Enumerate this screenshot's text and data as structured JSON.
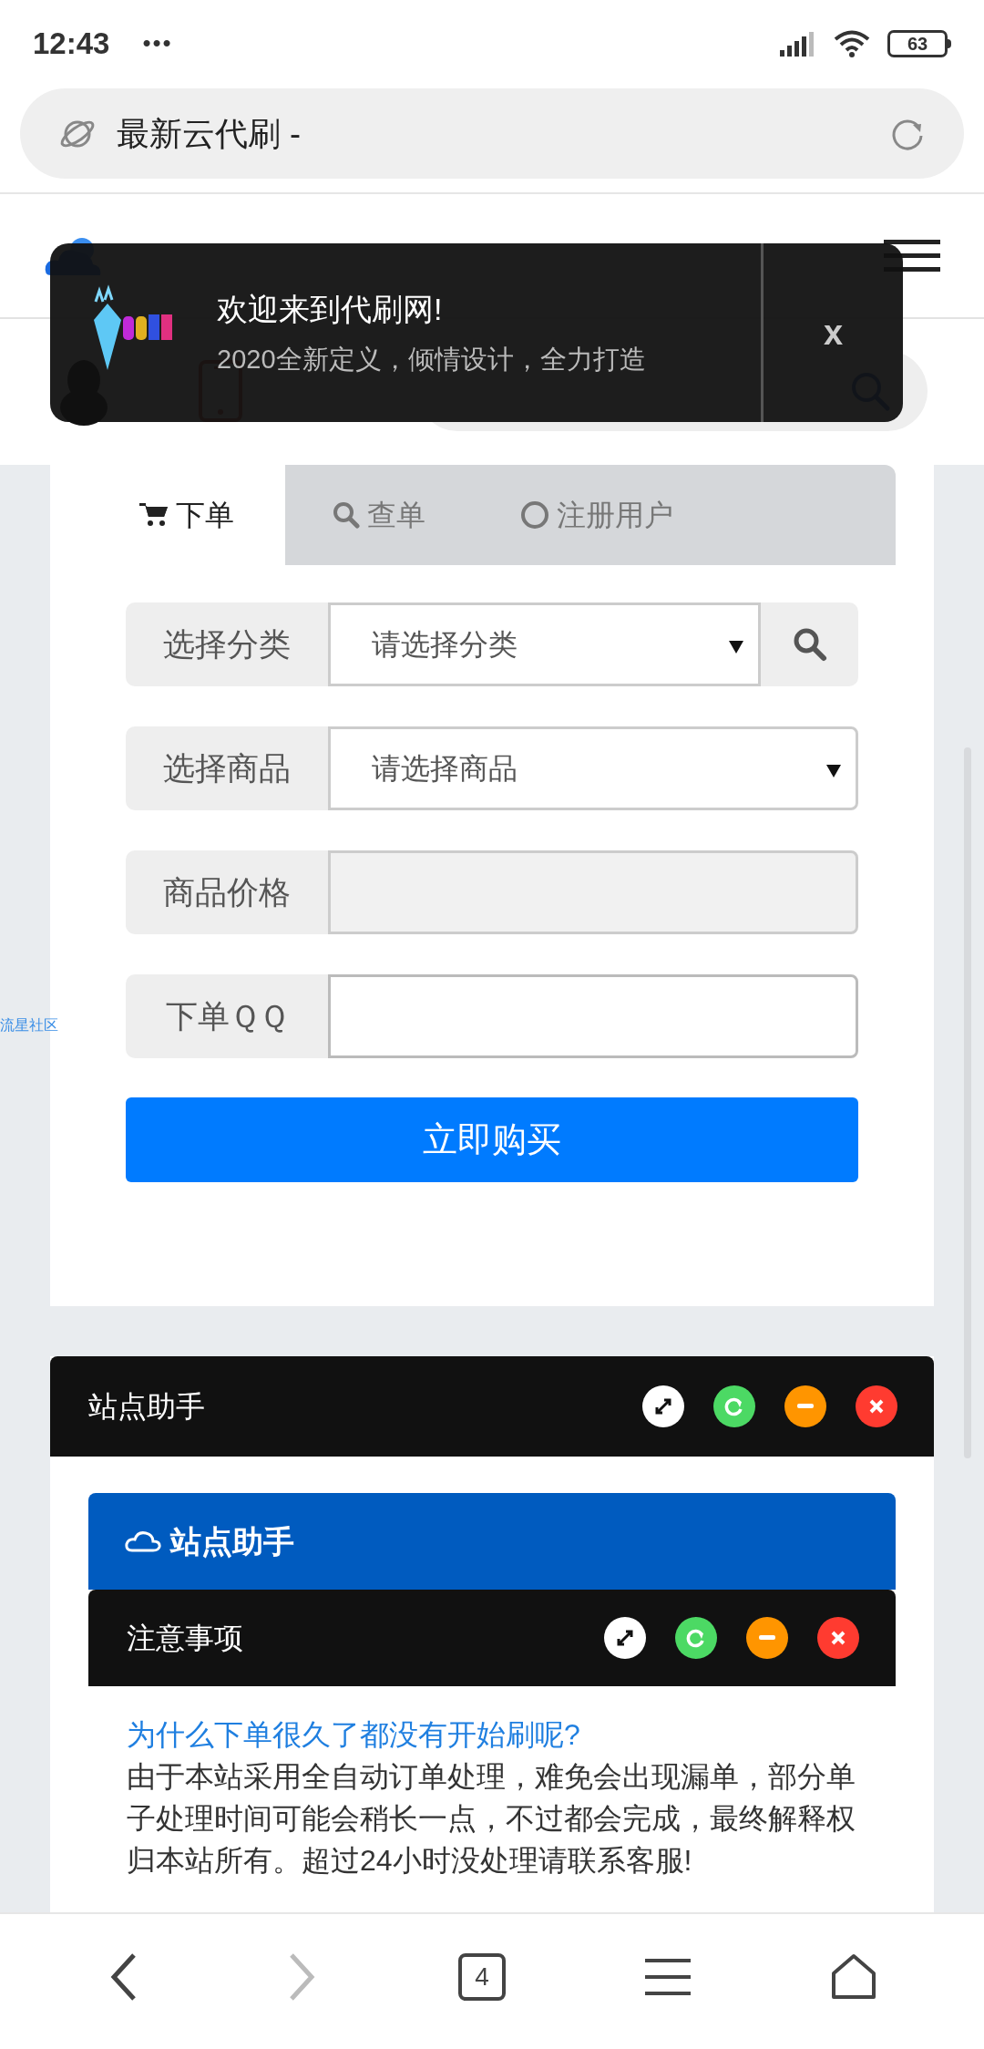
{
  "status_bar": {
    "time": "12:43",
    "dots": "•••",
    "battery": "63"
  },
  "address_bar": {
    "title": "最新云代刷 -"
  },
  "toast": {
    "title": "欢迎来到代刷网!",
    "message": "2020全新定义，倾情设计，全力打造",
    "close": "x"
  },
  "tabs": [
    {
      "label": "下单",
      "kind": "cart",
      "selected": true
    },
    {
      "label": "查单",
      "kind": "search",
      "selected": false
    },
    {
      "label": "注册用户",
      "kind": "ring",
      "selected": false
    }
  ],
  "form": {
    "fields": [
      {
        "label": "选择分类",
        "kind": "select_search",
        "value": "请选择分类"
      },
      {
        "label": "选择商品",
        "kind": "select",
        "value": "请选择商品"
      },
      {
        "label": "商品价格",
        "kind": "readonly"
      },
      {
        "label": "下单ＱＱ",
        "kind": "input"
      }
    ],
    "submit": "立即购买"
  },
  "side_link": "流星社区",
  "panel": {
    "title": "站点助手",
    "banner": "站点助手",
    "sub_panel": {
      "title": "注意事项"
    },
    "faq": {
      "question": "为什么下单很久了都没有开始刷呢?",
      "answer": "由于本站采用全自动订单处理，难免会出现漏单，部分单子处理时间可能会稍长一点，不过都会完成，最终解释权归本站所有。超过24小时没处理请联系客服!"
    }
  },
  "bottom_nav": {
    "tab_count": "4"
  }
}
